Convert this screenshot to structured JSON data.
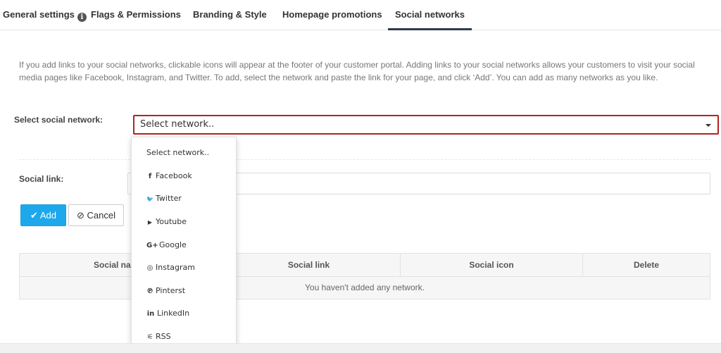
{
  "tabs": [
    {
      "label": "General settings",
      "active": false
    },
    {
      "label": "Flags & Permissions",
      "active": false
    },
    {
      "label": "Branding & Style",
      "active": false
    },
    {
      "label": "Homepage promotions",
      "active": false
    },
    {
      "label": "Social networks",
      "active": true
    }
  ],
  "info_icon": {
    "glyph": "i"
  },
  "intro_text": "If you add links to your social networks, clickable icons will appear at the footer of your customer portal. Adding links to your social networks allows your customers to visit your social media pages like Facebook, Instagram, and Twitter. To add, select the network and paste the link for your page, and click ‘Add’. You can add as many networks as you like.",
  "form": {
    "network_label": "Select social network:",
    "network_value": "Select network..",
    "link_label": "Social link:",
    "link_value": ""
  },
  "buttons": {
    "add": "Add",
    "add_icon": "✔",
    "cancel": "Cancel",
    "cancel_icon": "⊘"
  },
  "table": {
    "headers": [
      "Social name",
      "Social link",
      "Social icon",
      "Delete"
    ],
    "empty_message": "You haven't added any network."
  },
  "dropdown": {
    "options": [
      {
        "label": "Select network..",
        "icon": ""
      },
      {
        "label": "Facebook",
        "icon": "f"
      },
      {
        "label": "Twitter",
        "icon": "🐦"
      },
      {
        "label": "Youtube",
        "icon": "▶"
      },
      {
        "label": "Google",
        "icon": "G+"
      },
      {
        "label": "Instagram",
        "icon": "◎"
      },
      {
        "label": "Pinterst",
        "icon": "℗"
      },
      {
        "label": "LinkedIn",
        "icon": "in"
      },
      {
        "label": "RSS",
        "icon": "⚟"
      }
    ]
  },
  "colors": {
    "accent": "#1ea8ec",
    "focus_border": "#b22222",
    "active_tab_underline": "#2f3a4a"
  }
}
